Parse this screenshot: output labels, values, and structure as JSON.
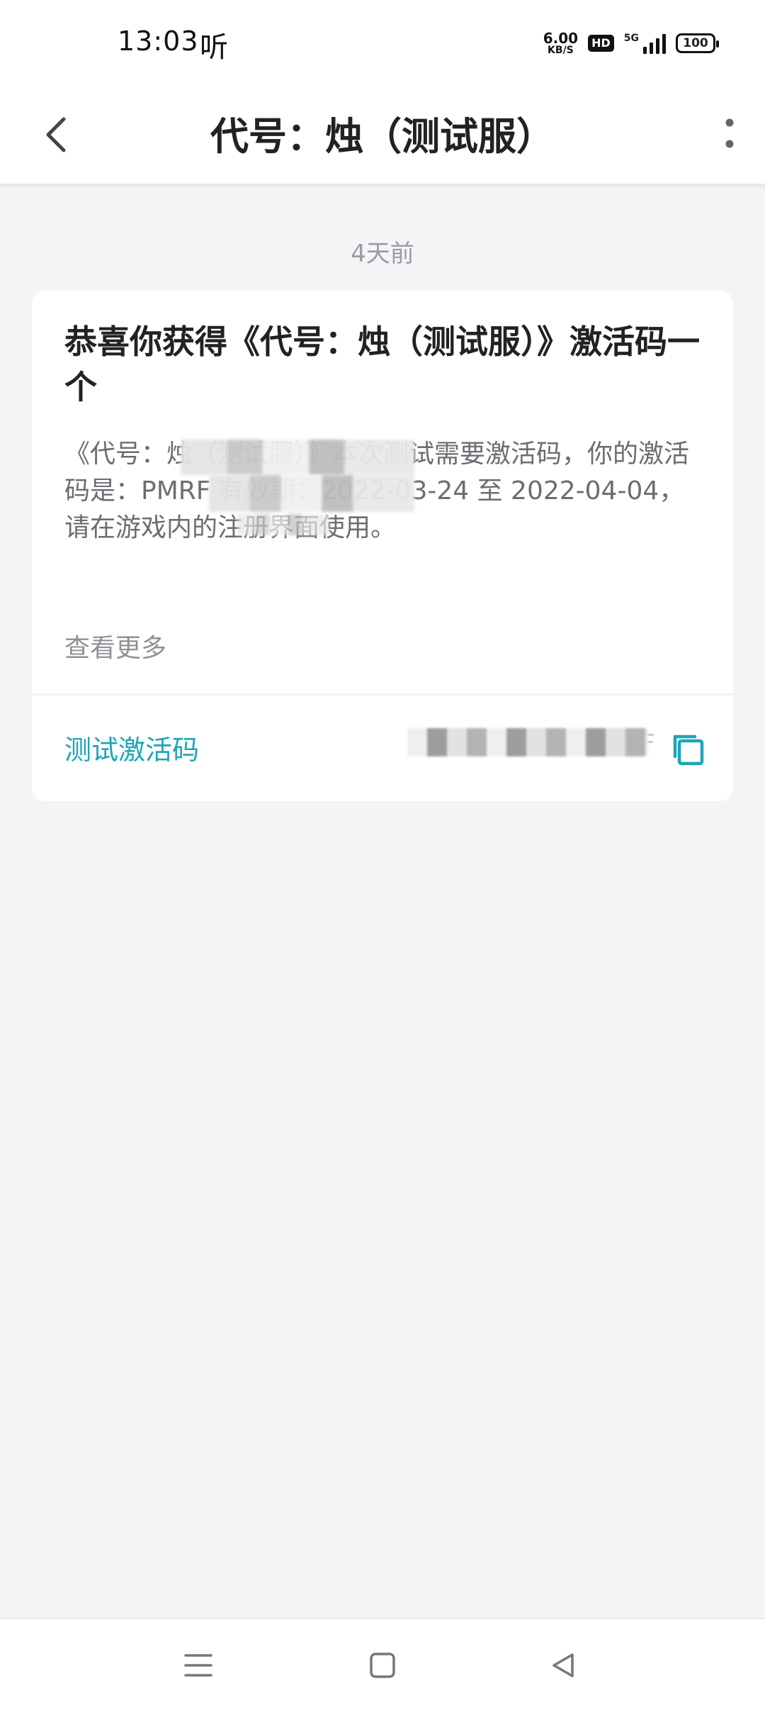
{
  "status_bar": {
    "time": "13:03",
    "listen_glyph": "听",
    "net_speed_value": "6.00",
    "net_speed_unit": "KB/S",
    "hd": "HD",
    "network": "5G",
    "battery": "100"
  },
  "header": {
    "title": "代号：烛（测试服）",
    "back_icon": "chevron-left-icon",
    "more_icon": "more-vertical-icon"
  },
  "message": {
    "timestamp": "4天前",
    "title": "恭喜你获得《代号：烛（测试服）》激活码一个",
    "body": "《代号：烛（测试服）》本次测试需要激活码，你的激活码是：PMRF 有效期：2022-03-24 至 2022-04-04，请在游戏内的注册界面使用。",
    "see_more": "查看更多",
    "code_label": "测试激活码",
    "code_value": "RF",
    "copy_icon": "copy-icon"
  },
  "nav": {
    "menu_icon": "menu-icon",
    "home_icon": "home-square-icon",
    "back_icon": "back-triangle-icon"
  },
  "colors": {
    "accent": "#1ea5b8",
    "background": "#f3f4f6",
    "card": "#ffffff"
  }
}
